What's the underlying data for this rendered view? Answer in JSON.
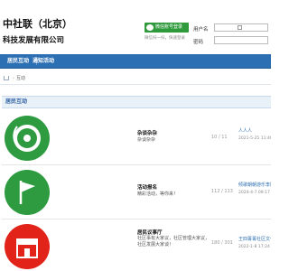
{
  "header": {
    "logo_line1": "中社联（北京）",
    "logo_line2": "科技发展有限公司",
    "wechat_button": "微信账号登录",
    "wechat_hint": "微信扫一扫，快速登录",
    "username_label": "用户名",
    "password_label": "密码"
  },
  "nav": {
    "items": [
      {
        "label": "居民互动"
      },
      {
        "label": "通知活动"
      }
    ]
  },
  "breadcrumb": {
    "separator": "›",
    "current": "互动"
  },
  "section": {
    "title": "居民互动"
  },
  "forums": [
    {
      "title": "杂谈杂杂",
      "desc": "杂谈杂杂",
      "count": "10 / 11",
      "last_title": "人人人",
      "last_time": "2021-5-25 11:40",
      "icon": "speaker-disc-icon",
      "color": "#2e9b40"
    },
    {
      "title": "活动报名",
      "desc": "精彩活动，等你来！",
      "count": "112 / 113",
      "last_title": "倾歌朝朝游乐李阳",
      "last_time": "2024-4-7 09:17 k",
      "icon": "flag-icon",
      "color": "#2e9b40"
    },
    {
      "title": "居民议事厅",
      "desc": "社区事有大家议，社区管理大家议，社区发展大家谈！",
      "count": "180 / 301",
      "last_title": "王四菁菁社区文化",
      "last_time": "2022-1-8 17:24 g",
      "icon": "shop-icon",
      "color": "#e2231a"
    }
  ],
  "colors": {
    "nav_bg": "#2d6fb3",
    "wechat_green": "#2f9a3c",
    "link_blue": "#2d6fb3"
  }
}
